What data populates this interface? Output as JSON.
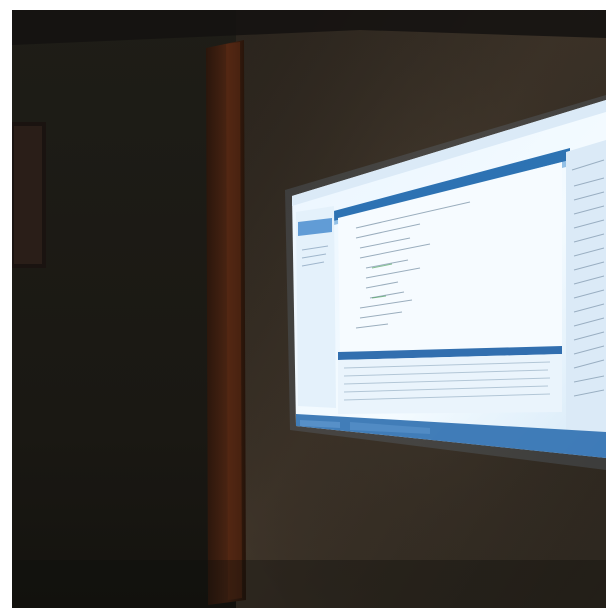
{
  "scene": {
    "description_items": [],
    "colors": {
      "wall_left": "#1b1a14",
      "wall_right": "#3b352b",
      "pillar": "#3b1f10",
      "pillar_glow": "#6a2e14",
      "frame": "#221a16",
      "screen_bg": "#eef7ff",
      "screen_accent": "#0b5aa6",
      "screen_panel": "#cfe5f7",
      "screen_text": "#6a7e90",
      "screen_highlight": "#2a78c6",
      "taskbar": "#2d6fb0",
      "taskbar_glow": "#5c95cc"
    }
  }
}
